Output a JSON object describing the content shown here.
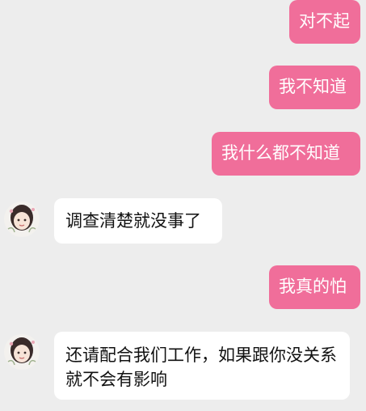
{
  "messages": [
    {
      "side": "out",
      "text": "对不起"
    },
    {
      "side": "out",
      "text": "我不知道"
    },
    {
      "side": "out",
      "text": "我什么都不知道"
    },
    {
      "side": "in",
      "text": "调查清楚就没事了"
    },
    {
      "side": "out",
      "text": "我真的怕"
    },
    {
      "side": "in",
      "text": "还请配合我们工作，如果跟你没关系就不会有影响"
    }
  ],
  "colors": {
    "background": "#ededed",
    "outgoing_bubble": "#f06e9a",
    "incoming_bubble": "#ffffff"
  },
  "icons": {
    "contact_avatar": "girl-illustration-avatar"
  }
}
